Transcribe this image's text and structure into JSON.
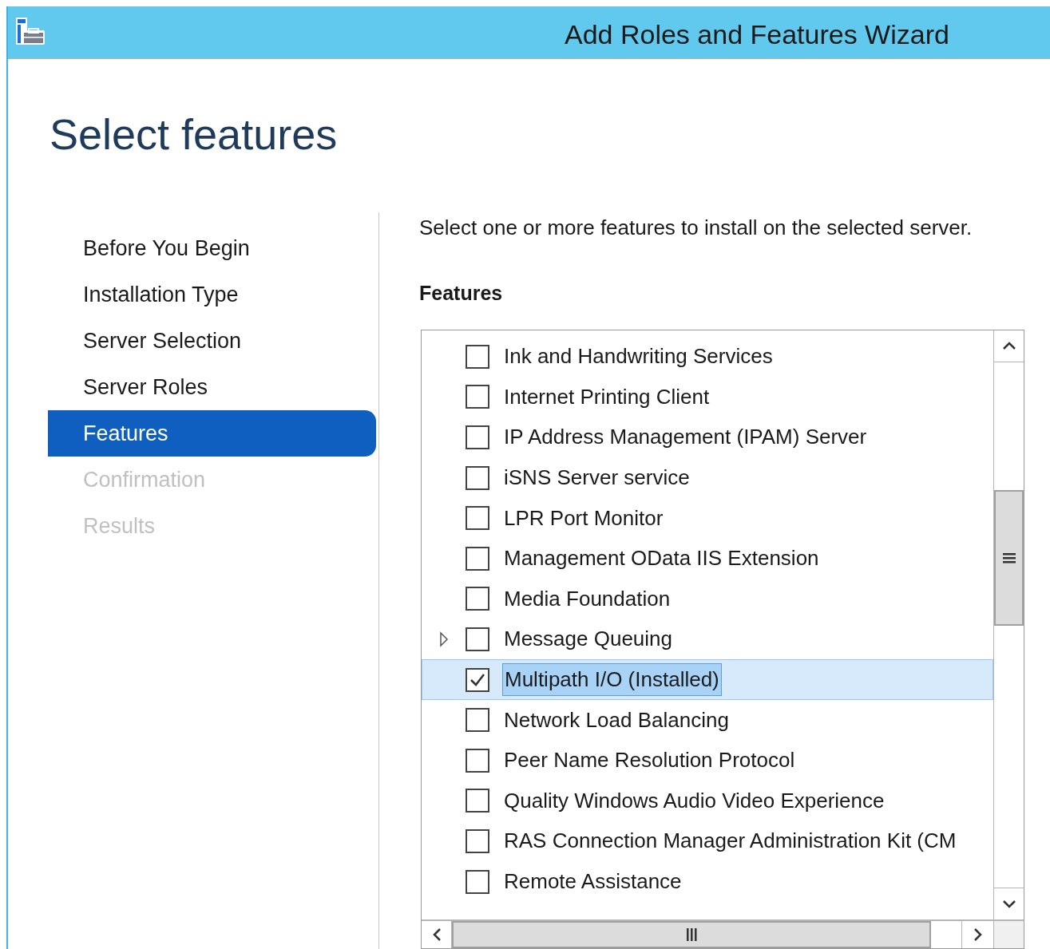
{
  "window": {
    "title": "Add Roles and Features Wizard"
  },
  "heading": "Select features",
  "steps": [
    {
      "label": "Before You Begin",
      "selected": false,
      "disabled": false
    },
    {
      "label": "Installation Type",
      "selected": false,
      "disabled": false
    },
    {
      "label": "Server Selection",
      "selected": false,
      "disabled": false
    },
    {
      "label": "Server Roles",
      "selected": false,
      "disabled": false
    },
    {
      "label": "Features",
      "selected": true,
      "disabled": false
    },
    {
      "label": "Confirmation",
      "selected": false,
      "disabled": true
    },
    {
      "label": "Results",
      "selected": false,
      "disabled": true
    }
  ],
  "description": "Select one or more features to install on the selected server.",
  "features_label": "Features",
  "features": [
    {
      "label": "Ink and Handwriting Services",
      "checked": false,
      "selected": false,
      "kind": "item"
    },
    {
      "label": "Internet Printing Client",
      "checked": false,
      "selected": false,
      "kind": "item"
    },
    {
      "label": "IP Address Management (IPAM) Server",
      "checked": false,
      "selected": false,
      "kind": "item"
    },
    {
      "label": "iSNS Server service",
      "checked": false,
      "selected": false,
      "kind": "item"
    },
    {
      "label": "LPR Port Monitor",
      "checked": false,
      "selected": false,
      "kind": "item"
    },
    {
      "label": "Management OData IIS Extension",
      "checked": false,
      "selected": false,
      "kind": "item"
    },
    {
      "label": "Media Foundation",
      "checked": false,
      "selected": false,
      "kind": "item"
    },
    {
      "label": "Message Queuing",
      "checked": false,
      "selected": false,
      "kind": "group"
    },
    {
      "label": "Multipath I/O (Installed)",
      "checked": true,
      "selected": true,
      "kind": "item"
    },
    {
      "label": "Network Load Balancing",
      "checked": false,
      "selected": false,
      "kind": "item"
    },
    {
      "label": "Peer Name Resolution Protocol",
      "checked": false,
      "selected": false,
      "kind": "item"
    },
    {
      "label": "Quality Windows Audio Video Experience",
      "checked": false,
      "selected": false,
      "kind": "item"
    },
    {
      "label": "RAS Connection Manager Administration Kit (CM",
      "checked": false,
      "selected": false,
      "kind": "item"
    },
    {
      "label": "Remote Assistance",
      "checked": false,
      "selected": false,
      "kind": "item"
    }
  ]
}
